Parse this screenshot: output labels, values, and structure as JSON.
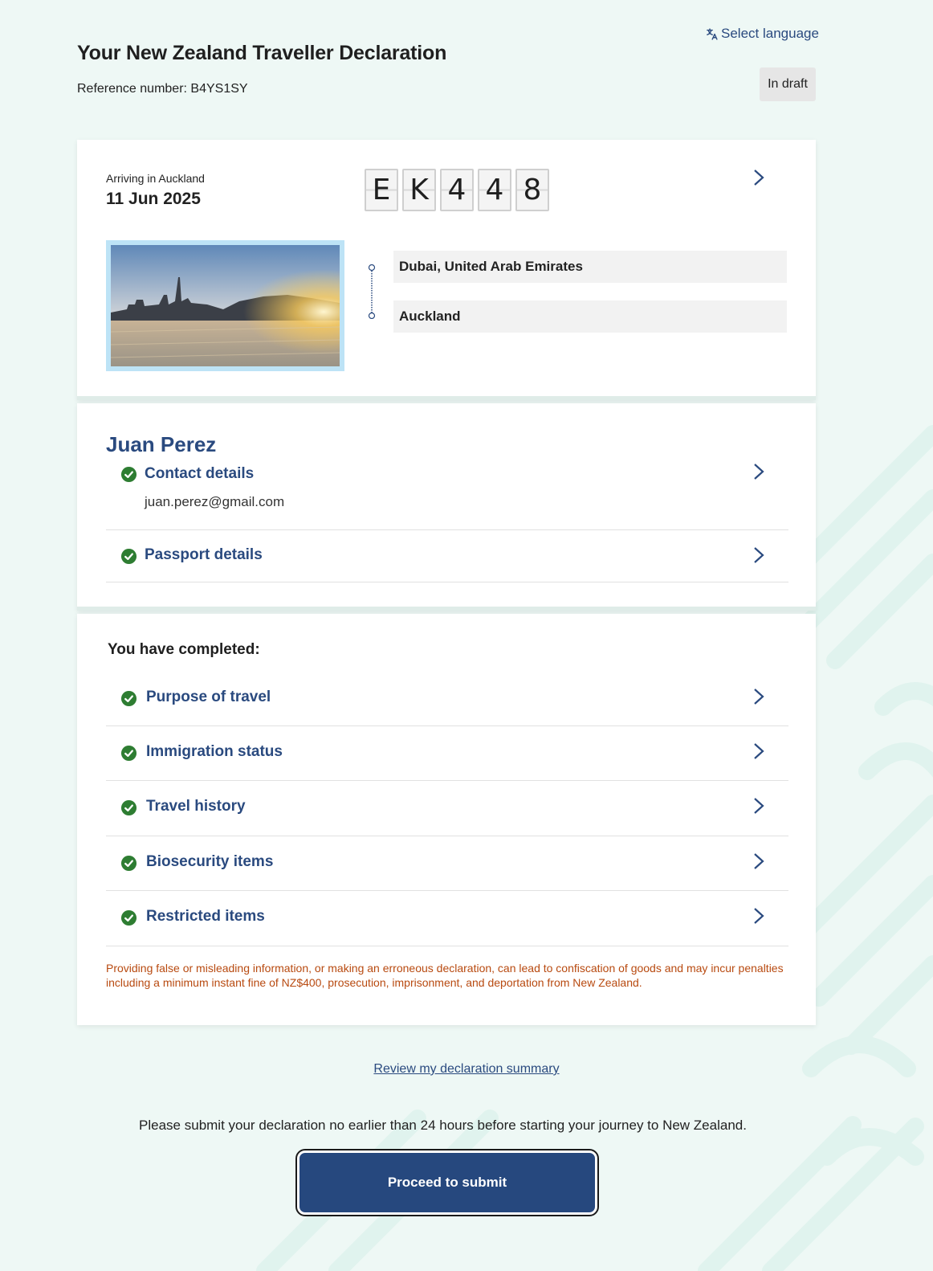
{
  "header": {
    "language_link": "Select language",
    "title": "Your New Zealand Traveller Declaration",
    "reference_line": "Reference number: B4YS1SY",
    "status": "In draft"
  },
  "flight": {
    "arriving_label": "Arriving in Auckland",
    "arrival_date": "11 Jun 2025",
    "flight_chars": [
      "E",
      "K",
      "4",
      "4",
      "8"
    ],
    "origin": "Dubai, United Arab Emirates",
    "destination": "Auckland"
  },
  "traveller": {
    "name": "Juan Perez",
    "contact_label": "Contact details",
    "contact_email": "juan.perez@gmail.com",
    "passport_label": "Passport details"
  },
  "sections": {
    "heading": "You have completed:",
    "items": [
      {
        "label": "Purpose of travel"
      },
      {
        "label": "Immigration status"
      },
      {
        "label": "Travel history"
      },
      {
        "label": "Biosecurity items"
      },
      {
        "label": "Restricted items"
      }
    ],
    "warning": "Providing false or misleading information, or making an erroneous declaration, can lead to confiscation of goods and may incur penalties including a minimum instant fine of NZ$400, prosecution, imprisonment, and deportation from New Zealand."
  },
  "footer": {
    "review_link": "Review my declaration summary",
    "submit_note": "Please submit your declaration no earlier than 24 hours before starting your journey to New Zealand.",
    "submit_button": "Proceed to submit"
  },
  "colors": {
    "primary": "#2a4a7f",
    "button": "#26487e",
    "check": "#2e7d32",
    "warning": "#b84a10",
    "background": "#eef8f5"
  }
}
